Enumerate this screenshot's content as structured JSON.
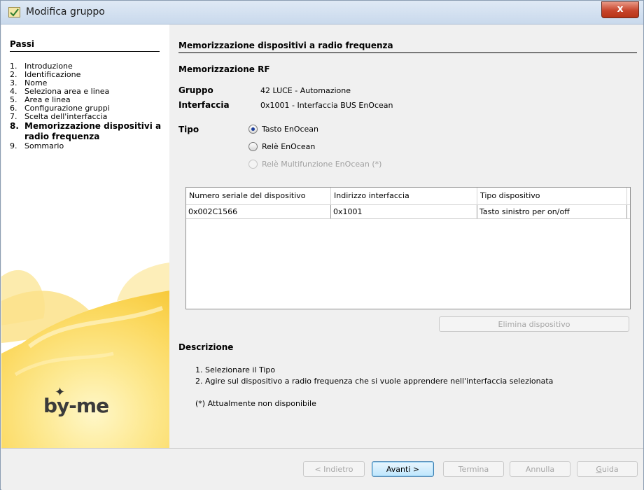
{
  "window": {
    "title": "Modifica gruppo",
    "close_label": "x"
  },
  "sidebar": {
    "title": "Passi",
    "steps": [
      {
        "num": "1.",
        "label": "Introduzione"
      },
      {
        "num": "2.",
        "label": "Identificazione"
      },
      {
        "num": "3.",
        "label": "Nome"
      },
      {
        "num": "4.",
        "label": "Seleziona area e linea"
      },
      {
        "num": "5.",
        "label": "Area e linea"
      },
      {
        "num": "6.",
        "label": "Configurazione gruppi"
      },
      {
        "num": "7.",
        "label": "Scelta dell'interfaccia"
      },
      {
        "num": "8.",
        "label": "Memorizzazione dispositivi a radio frequenza"
      },
      {
        "num": "9.",
        "label": "Sommario"
      }
    ],
    "active_step": 8,
    "logo_text": "by-me"
  },
  "main": {
    "title": "Memorizzazione dispositivi a radio frequenza",
    "subtitle": "Memorizzazione RF",
    "gruppo_label": "Gruppo",
    "gruppo_value": "42  LUCE  - Automazione",
    "interfaccia_label": "Interfaccia",
    "interfaccia_value": "0x1001 - Interfaccia BUS EnOcean",
    "tipo_label": "Tipo",
    "tipo_options": [
      {
        "label": "Tasto EnOcean",
        "selected": true,
        "disabled": false
      },
      {
        "label": "Relè EnOcean",
        "selected": false,
        "disabled": false
      },
      {
        "label": "Relè Multifunzione EnOcean (*)",
        "selected": false,
        "disabled": true
      }
    ],
    "table": {
      "columns": [
        "Numero seriale del dispositivo",
        "Indirizzo interfaccia",
        "Tipo dispositivo"
      ],
      "rows": [
        [
          "0x002C1566",
          "0x1001",
          "Tasto sinistro per on/off"
        ]
      ]
    },
    "delete_button": "Elimina dispositivo",
    "description_title": "Descrizione",
    "description_lines": [
      "1. Selezionare il Tipo",
      "2. Agire sul dispositivo a radio frequenza che si vuole apprendere nell'interfaccia selezionata",
      "(*) Attualmente non disponibile"
    ]
  },
  "footer": {
    "back": "< Indietro",
    "next": "Avanti >",
    "finish": "Termina",
    "cancel": "Annulla",
    "help_first": "G",
    "help_rest": "uida"
  },
  "colors": {
    "titlebar": "#c9d9ec",
    "close_button": "#c7452c",
    "sidebar_sun": "#fbd34a",
    "accent_radio": "#1a3d9b"
  }
}
